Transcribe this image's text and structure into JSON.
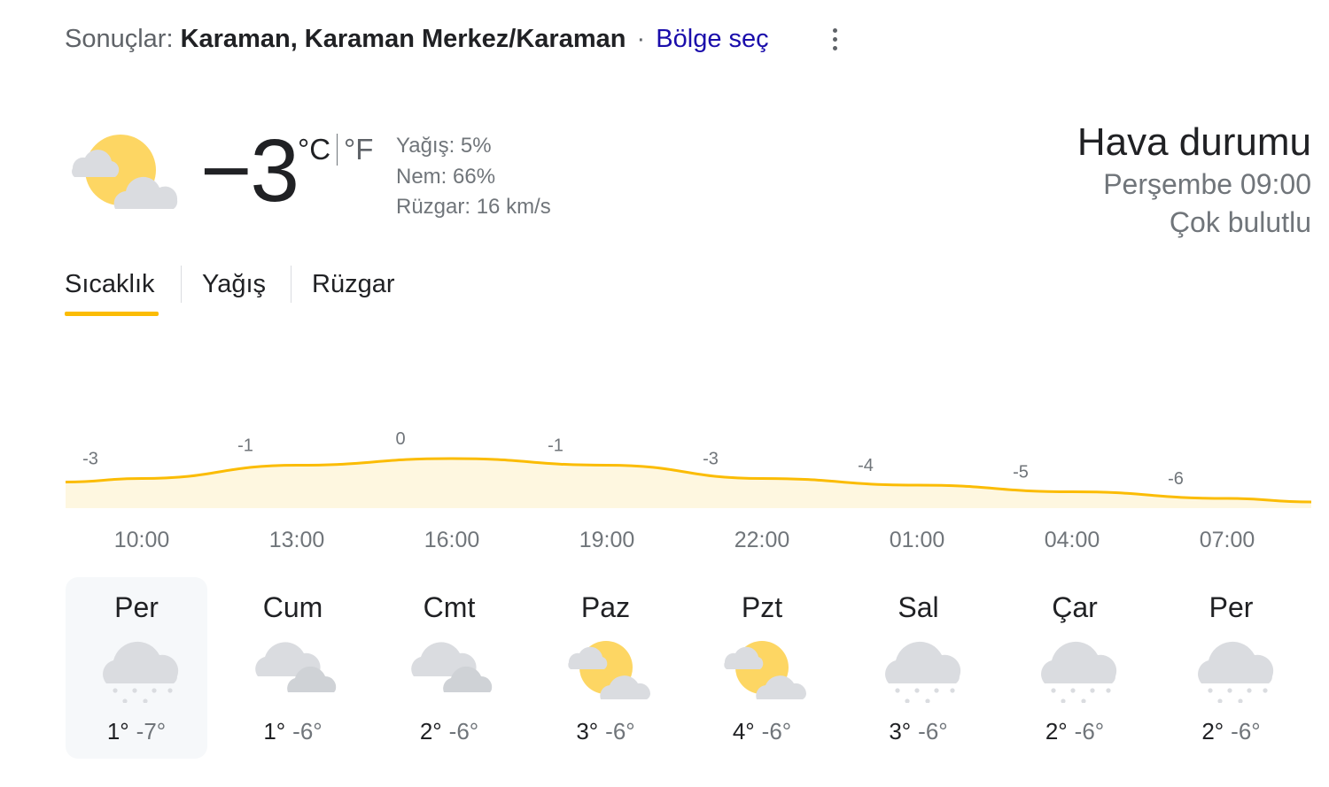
{
  "header": {
    "prefix": "Sonuçlar:",
    "place": "Karaman, Karaman Merkez/Karaman",
    "separator": "·",
    "region_link": "Bölge seç"
  },
  "current": {
    "icon": "partly-cloudy-icon",
    "temperature": "−3",
    "unit_c": "°C",
    "unit_f": "°F",
    "precipitation": "Yağış: 5%",
    "humidity": "Nem: 66%",
    "wind": "Rüzgar: 16 km/s"
  },
  "summary": {
    "title": "Hava durumu",
    "day_time": "Perşembe 09:00",
    "condition": "Çok bulutlu"
  },
  "tabs": [
    {
      "label": "Sıcaklık",
      "active": true
    },
    {
      "label": "Yağış",
      "active": false
    },
    {
      "label": "Rüzgar",
      "active": false
    }
  ],
  "chart_data": {
    "type": "area",
    "x": [
      "10:00",
      "13:00",
      "16:00",
      "19:00",
      "22:00",
      "01:00",
      "04:00",
      "07:00"
    ],
    "values": [
      -3,
      -1,
      0,
      -1,
      -3,
      -4,
      -5,
      -6
    ],
    "labels": [
      "-3",
      "-1",
      "0",
      "-1",
      "-3",
      "-4",
      "-5",
      "-6"
    ],
    "line_color": "#fbbc04",
    "fill_color": "#fef7e0"
  },
  "forecast": [
    {
      "day": "Per",
      "icon": "snow-icon",
      "high": "1°",
      "low": "-7°",
      "selected": true
    },
    {
      "day": "Cum",
      "icon": "cloudy-icon",
      "high": "1°",
      "low": "-6°",
      "selected": false
    },
    {
      "day": "Cmt",
      "icon": "cloudy-icon",
      "high": "2°",
      "low": "-6°",
      "selected": false
    },
    {
      "day": "Paz",
      "icon": "partly-cloudy-icon",
      "high": "3°",
      "low": "-6°",
      "selected": false
    },
    {
      "day": "Pzt",
      "icon": "partly-cloudy-icon",
      "high": "4°",
      "low": "-6°",
      "selected": false
    },
    {
      "day": "Sal",
      "icon": "snow-icon",
      "high": "3°",
      "low": "-6°",
      "selected": false
    },
    {
      "day": "Çar",
      "icon": "snow-icon",
      "high": "2°",
      "low": "-6°",
      "selected": false
    },
    {
      "day": "Per",
      "icon": "snow-icon",
      "high": "2°",
      "low": "-6°",
      "selected": false
    }
  ]
}
